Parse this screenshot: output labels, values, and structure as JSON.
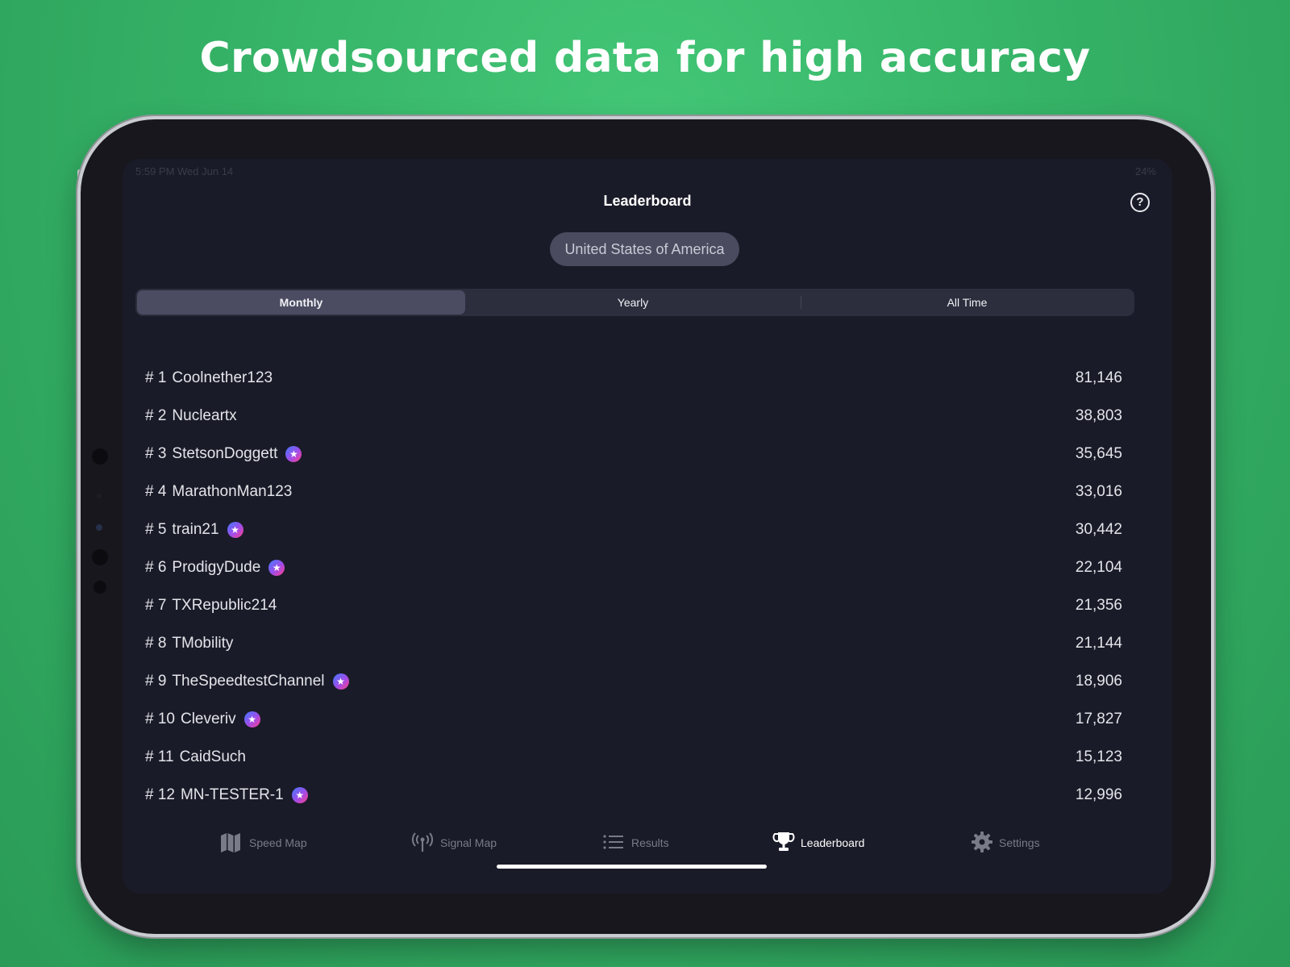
{
  "headline": "Crowdsourced data for high accuracy",
  "status_bar": {
    "time": "5:59 PM  Wed Jun 14",
    "battery": "24%"
  },
  "nav": {
    "title": "Leaderboard",
    "help_icon": "question-circle-icon",
    "help_glyph": "?"
  },
  "country": {
    "label": "United States of America"
  },
  "period_tabs": [
    {
      "label": "Monthly",
      "selected": true
    },
    {
      "label": "Yearly",
      "selected": false
    },
    {
      "label": "All Time",
      "selected": false
    }
  ],
  "leaderboard": [
    {
      "rank": "# 1",
      "name": "Coolnether123",
      "score": "81,146",
      "badge": false
    },
    {
      "rank": "# 2",
      "name": "Nucleartx",
      "score": "38,803",
      "badge": false
    },
    {
      "rank": "# 3",
      "name": "StetsonDoggett",
      "score": "35,645",
      "badge": true
    },
    {
      "rank": "# 4",
      "name": "MarathonMan123",
      "score": "33,016",
      "badge": false
    },
    {
      "rank": "# 5",
      "name": "train21",
      "score": "30,442",
      "badge": true
    },
    {
      "rank": "# 6",
      "name": "ProdigyDude",
      "score": "22,104",
      "badge": true
    },
    {
      "rank": "# 7",
      "name": "TXRepublic214",
      "score": "21,356",
      "badge": false
    },
    {
      "rank": "# 8",
      "name": "TMobility",
      "score": "21,144",
      "badge": false
    },
    {
      "rank": "# 9",
      "name": "TheSpeedtestChannel",
      "score": "18,906",
      "badge": true
    },
    {
      "rank": "# 10",
      "name": "Cleveriv",
      "score": "17,827",
      "badge": true
    },
    {
      "rank": "# 11",
      "name": "CaidSuch",
      "score": "15,123",
      "badge": false
    },
    {
      "rank": "# 12",
      "name": "MN-TESTER-1",
      "score": "12,996",
      "badge": true
    }
  ],
  "badge": {
    "icon": "star-badge-icon",
    "glyph": "★"
  },
  "tab_bar": [
    {
      "label": "Speed Map",
      "icon": "map-icon",
      "active": false
    },
    {
      "label": "Signal Map",
      "icon": "antenna-icon",
      "active": false
    },
    {
      "label": "Results",
      "icon": "list-icon",
      "active": false
    },
    {
      "label": "Leaderboard",
      "icon": "trophy-icon",
      "active": true
    },
    {
      "label": "Settings",
      "icon": "gear-icon",
      "active": false
    }
  ],
  "colors": {
    "background_green": "#35b266",
    "screen_background": "#1a1b28",
    "segment_active": "#4b4c62",
    "tab_active": "#ffffff",
    "tab_inactive": "#7a7b88"
  }
}
